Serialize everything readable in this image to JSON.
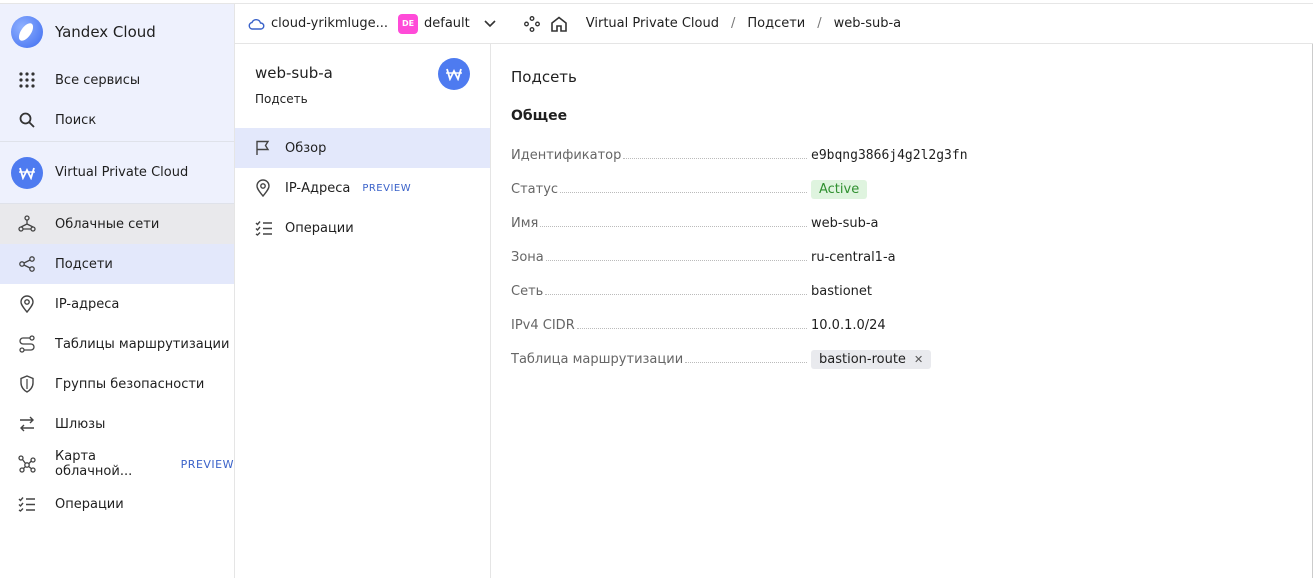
{
  "brand": "Yandex Cloud",
  "sidebar": {
    "top_items": [
      {
        "label": "Все сервисы",
        "icon": "grid-icon"
      },
      {
        "label": "Поиск",
        "icon": "search-icon"
      }
    ],
    "service": {
      "label": "Virtual Private Cloud",
      "icon": "vpc-icon"
    },
    "nav": [
      {
        "label": "Облачные сети",
        "icon": "cloud-networks-icon"
      },
      {
        "label": "Подсети",
        "icon": "subnets-icon"
      },
      {
        "label": "IP-адреса",
        "icon": "location-pin-icon"
      },
      {
        "label": "Таблицы маршрутизации",
        "icon": "route-icon"
      },
      {
        "label": "Группы безопасности",
        "icon": "shield-icon"
      },
      {
        "label": "Шлюзы",
        "icon": "gateway-arrows-icon"
      },
      {
        "label": "Карта облачной...",
        "icon": "map-graph-icon",
        "badge": "PREVIEW"
      },
      {
        "label": "Операции",
        "icon": "list-check-icon"
      }
    ]
  },
  "header": {
    "cloud": "cloud-yrikmluge...",
    "folder_badge": "DE",
    "folder": "default",
    "breadcrumbs": [
      "Virtual Private Cloud",
      "Подсети",
      "web-sub-a"
    ]
  },
  "resource": {
    "name": "web-sub-a",
    "type": "Подсеть",
    "menu": [
      {
        "label": "Обзор",
        "icon": "flag-icon"
      },
      {
        "label": "IP-Адреса",
        "icon": "location-pin-icon",
        "badge": "PREVIEW"
      },
      {
        "label": "Операции",
        "icon": "list-check-icon"
      }
    ]
  },
  "main": {
    "title": "Подсеть",
    "section": "Общее",
    "fields": {
      "id_label": "Идентификатор",
      "id_value": "e9bqng3866j4g2l2g3fn",
      "status_label": "Статус",
      "status_value": "Active",
      "name_label": "Имя",
      "name_value": "web-sub-a",
      "zone_label": "Зона",
      "zone_value": "ru-central1-a",
      "network_label": "Сеть",
      "network_value": "bastionet",
      "cidr_label": "IPv4 CIDR",
      "cidr_value": "10.0.1.0/24",
      "rt_label": "Таблица маршрутизации",
      "rt_value": "bastion-route"
    }
  },
  "colors": {
    "accent": "#4e7bf0",
    "status_bg": "#dff4df",
    "status_fg": "#2f8f2f",
    "folder_badge": "#ff4bd8"
  }
}
